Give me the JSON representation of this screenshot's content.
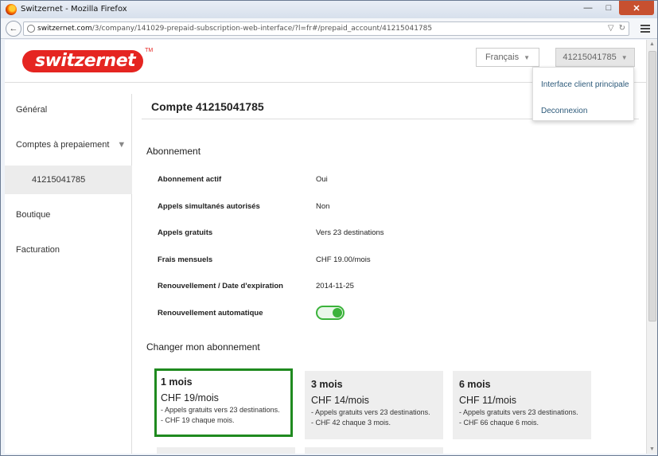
{
  "window": {
    "title": "Switzernet - Mozilla Firefox",
    "minimize": "—",
    "maximize": "□",
    "close": "✕"
  },
  "browser": {
    "url_host": "switzernet.com",
    "url_path": "/3/company/141029-prepaid-subscription-web-interface/?l=fr#/prepaid_account/41215041785",
    "back_icon": "←",
    "star_icon": "▽",
    "reload_icon": "↻"
  },
  "header": {
    "logo_text": "switzernet",
    "logo_tm": "TM",
    "language_button": "Français",
    "account_button": "41215041785",
    "dropdown": {
      "items": [
        "Interface client principale",
        "Deconnexion"
      ]
    }
  },
  "sidebar": {
    "items": [
      {
        "label": "Général"
      },
      {
        "label": "Comptes à prepaiement"
      },
      {
        "label": "41215041785"
      },
      {
        "label": "Boutique"
      },
      {
        "label": "Facturation"
      }
    ]
  },
  "main": {
    "title": "Compte 41215041785",
    "subscription_section": "Abonnement",
    "rows": [
      {
        "label": "Abonnement actif",
        "value": "Oui"
      },
      {
        "label": "Appels simultanés autorisés",
        "value": "Non"
      },
      {
        "label": "Appels gratuits",
        "value": "Vers 23 destinations"
      },
      {
        "label": "Frais mensuels",
        "value": "CHF 19.00/mois"
      },
      {
        "label": "Renouvellement / Date d'expiration",
        "value": "2014-11-25"
      },
      {
        "label": "Renouvellement automatique",
        "toggle_on": true
      }
    ],
    "change_section": "Changer mon abonnement",
    "plans": [
      {
        "duration": "1 mois",
        "price": "CHF 19/mois",
        "line1": "- Appels gratuits vers 23 destinations.",
        "line2": "- CHF 19 chaque mois.",
        "selected": true
      },
      {
        "duration": "3 mois",
        "price": "CHF 14/mois",
        "line1": "- Appels gratuits vers 23 destinations.",
        "line2": "- CHF 42 chaque 3 mois.",
        "selected": false
      },
      {
        "duration": "6 mois",
        "price": "CHF 11/mois",
        "line1": "- Appels gratuits vers 23 destinations.",
        "line2": "- CHF 66 chaque 6 mois.",
        "selected": false
      }
    ]
  },
  "colors": {
    "brand_red": "#e52521",
    "selected_green": "#1f8a1f",
    "toggle_green": "#3bb33b",
    "link_blue": "#2d5a7a"
  }
}
